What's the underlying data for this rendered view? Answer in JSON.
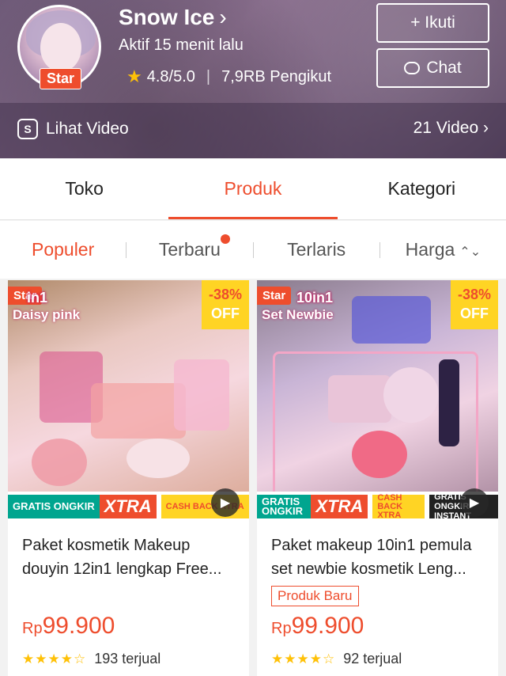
{
  "shop": {
    "name": "Snow Ice",
    "status": "Aktif 15 menit lalu",
    "badge": "Star",
    "rating": "4.8/5.0",
    "followers": "7,9RB Pengikut",
    "follow_label": "+ Ikuti",
    "chat_label": "Chat",
    "video_label": "Lihat Video",
    "video_count": "21 Video",
    "accent": "#ee4d2d"
  },
  "tabs": [
    {
      "label": "Toko"
    },
    {
      "label": "Produk"
    },
    {
      "label": "Kategori"
    }
  ],
  "filters": [
    {
      "label": "Populer"
    },
    {
      "label": "Terbaru"
    },
    {
      "label": "Terlaris"
    },
    {
      "label": "Harga"
    }
  ],
  "products": [
    {
      "star": "Star",
      "discount": "-38%",
      "off": "OFF",
      "art_line1": "in1",
      "art_line2": "Daisy pink",
      "name": "Paket kosmetik Makeup douyin 12in1 lengkap Free...",
      "currency": "Rp",
      "price": "99.900",
      "sold": "193 terjual",
      "stars": "★★★★☆",
      "gratis": "GRATIS ONGKIR",
      "xtra": "XTRA",
      "cash": "CASH BACK XTRA"
    },
    {
      "star": "Star",
      "discount": "-38%",
      "off": "OFF",
      "art_line1": "10in1",
      "art_line2": "Set Newbie",
      "name": "Paket makeup 10in1 pemula set newbie kosmetik Leng...",
      "new_badge": "Produk Baru",
      "currency": "Rp",
      "price": "99.900",
      "sold": "92 terjual",
      "stars": "★★★★☆",
      "gratis": "GRATIS ONGKIR",
      "xtra": "XTRA",
      "cash": "CASH BACK XTRA",
      "instant": "GRATIS ONGKIR INSTANT"
    }
  ]
}
